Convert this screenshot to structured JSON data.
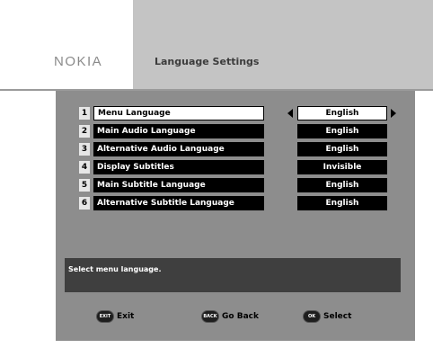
{
  "header": {
    "logo": "NOKIA",
    "title": "Language Settings"
  },
  "menu": {
    "items": [
      {
        "number": "1",
        "label": "Menu Language",
        "value": "English",
        "selected": true
      },
      {
        "number": "2",
        "label": "Main Audio Language",
        "value": "English"
      },
      {
        "number": "3",
        "label": "Alternative Audio Language",
        "value": "English"
      },
      {
        "number": "4",
        "label": "Display Subtitles",
        "value": "Invisible"
      },
      {
        "number": "5",
        "label": "Main Subtitle Language",
        "value": "English"
      },
      {
        "number": "6",
        "label": "Alternative Subtitle Language",
        "value": "English"
      }
    ]
  },
  "help": {
    "text": "Select menu language."
  },
  "footer": {
    "exit": {
      "key": "EXIT",
      "label": "Exit"
    },
    "back": {
      "key": "BACK",
      "label": "Go Back"
    },
    "select": {
      "key": "OK",
      "label": "Select"
    }
  },
  "colors": {
    "header_bg": "#c4c4c4",
    "panel_bg": "#8d8d8d",
    "row_bg": "#000000",
    "selected_bg": "#ffffff",
    "help_bg": "#3f3f3f"
  },
  "icons": {
    "left_arrow": "left-arrow-icon",
    "right_arrow": "right-arrow-icon"
  }
}
